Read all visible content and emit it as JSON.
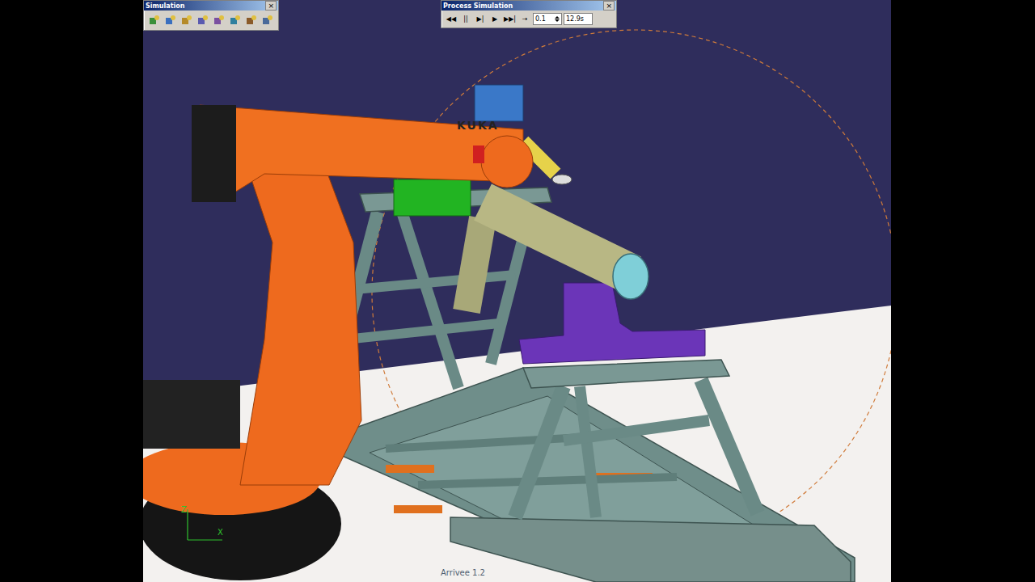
{
  "simulation_toolbar": {
    "title": "Simulation",
    "close": "×"
  },
  "process_simulation": {
    "title": "Process Simulation",
    "close": "×",
    "controls": [
      "◀◀",
      "||",
      "▶|",
      "▶",
      "▶▶|",
      "→"
    ],
    "step": "0.1",
    "time": "12.9s"
  },
  "scene": {
    "robot_brand": "KUKA",
    "axes": [
      "Z",
      "X"
    ],
    "footer": "Arrivee 1.2"
  }
}
